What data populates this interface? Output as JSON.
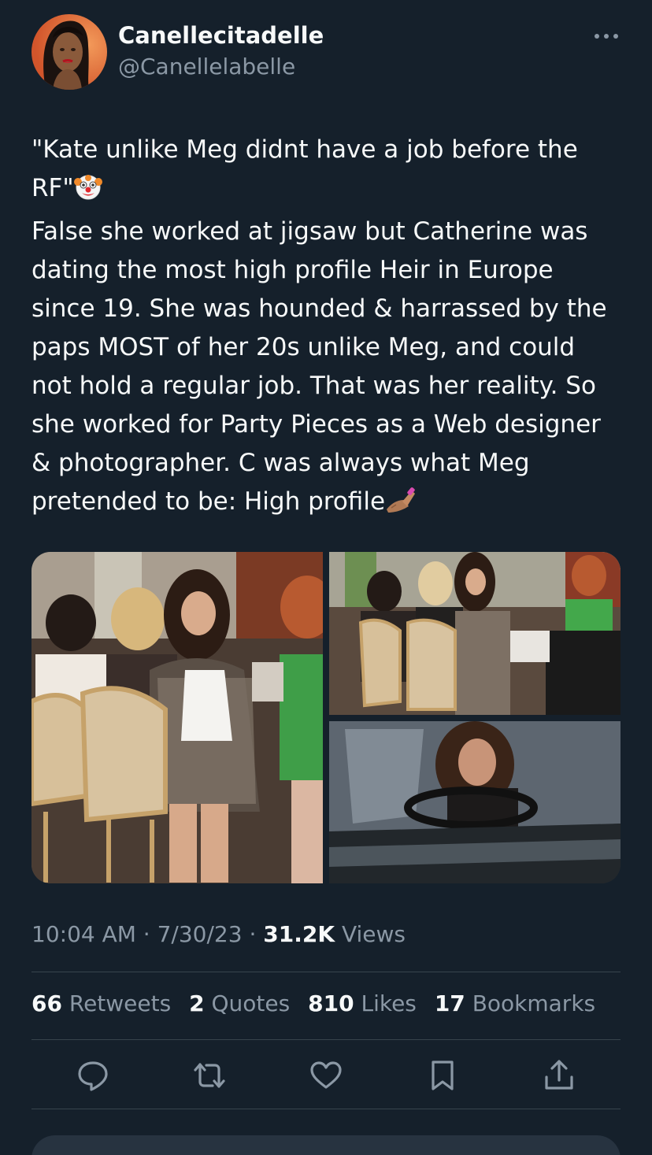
{
  "user": {
    "display_name": "Canellecitadelle",
    "handle": "@Canellelabelle"
  },
  "tweet": {
    "lines": [
      "\"Kate unlike Meg didnt have a job before the",
      "RF\"",
      "False she worked at jigsaw but Catherine was",
      "dating the most high profile Heir in Europe",
      "since 19. She was hounded & harrassed by the",
      "paps MOST of her 20s unlike Meg, and could",
      "not hold a regular job. That was her reality. So",
      "she worked for Party Pieces as a Web designer",
      "& photographer. C was always what Meg",
      "pretended to be: High profile"
    ],
    "emojis": [
      "clown-face-emoji",
      "nail-polish-emoji"
    ]
  },
  "meta": {
    "time": "10:04 AM",
    "date": "7/30/23",
    "sep": " · ",
    "views_count": "31.2K",
    "views_label": "Views"
  },
  "stats": {
    "retweets_count": "66",
    "retweets_label": "Retweets",
    "quotes_count": "2",
    "quotes_label": "Quotes",
    "likes_count": "810",
    "likes_label": "Likes",
    "bookmarks_count": "17",
    "bookmarks_label": "Bookmarks"
  },
  "actions": [
    "reply-icon",
    "retweet-icon",
    "like-icon",
    "bookmark-icon",
    "share-icon"
  ],
  "colors": {
    "background": "#15202b",
    "text": "#f7f9f9",
    "secondary": "#8b98a5",
    "divider": "#38444d"
  }
}
